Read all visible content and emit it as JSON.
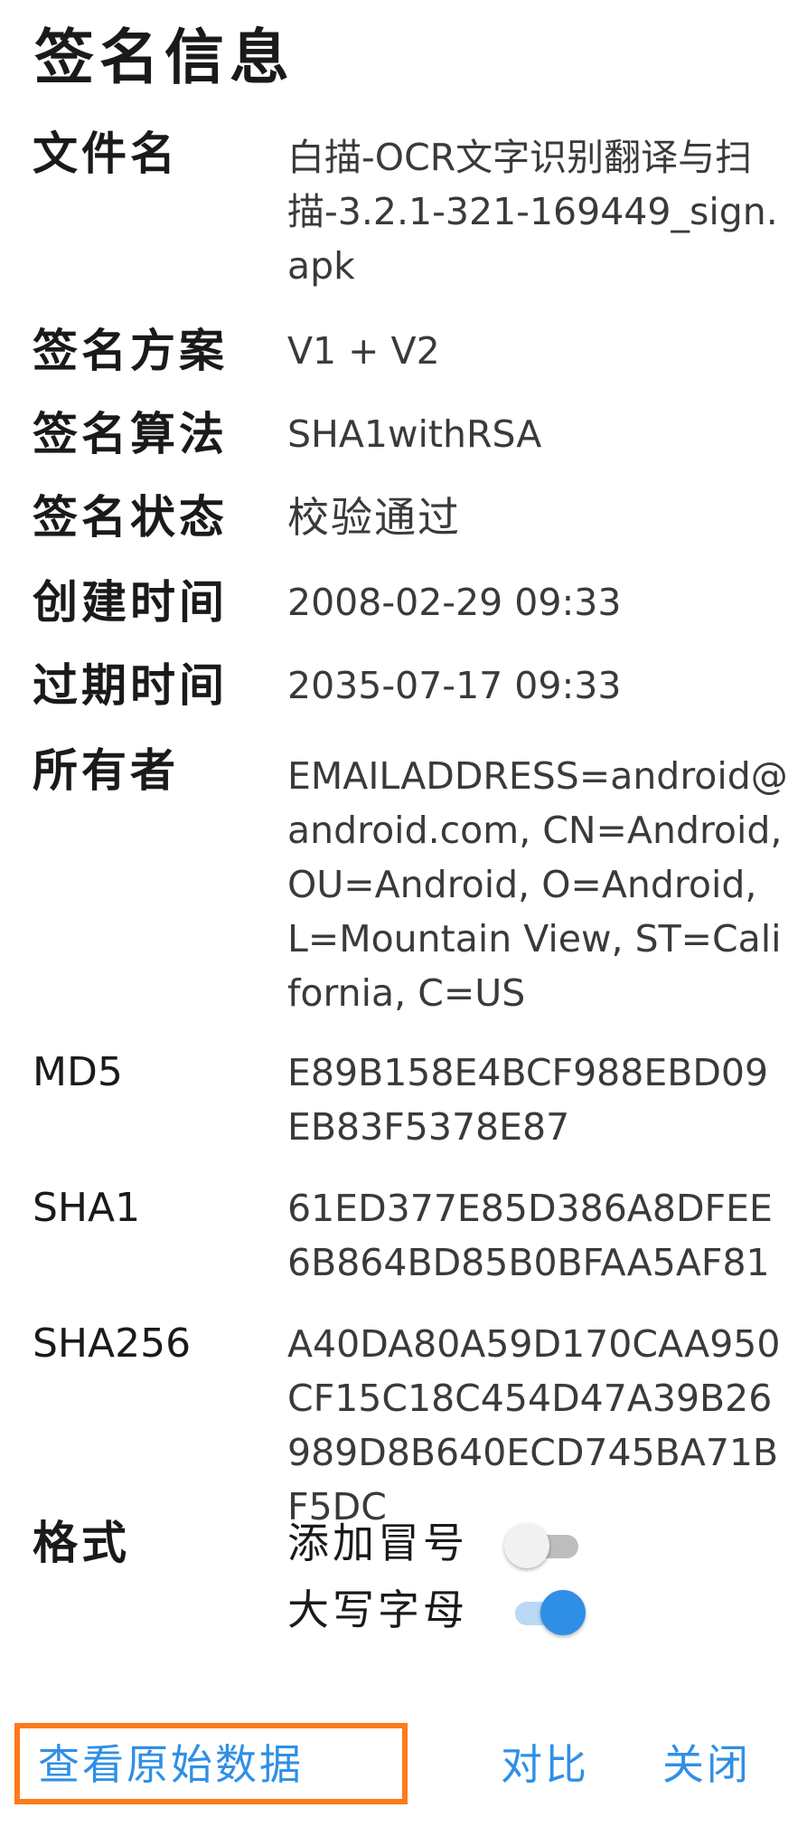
{
  "dialog": {
    "title": "签名信息",
    "fields": {
      "filename_label": "文件名",
      "filename_value": "白描-OCR文字识别翻译与扫描-3.2.1-321-169449_sign.apk",
      "scheme_label": "签名方案",
      "scheme_value": "V1 + V2",
      "algorithm_label": "签名算法",
      "algorithm_value": "SHA1withRSA",
      "status_label": "签名状态",
      "status_value": "校验通过",
      "created_label": "创建时间",
      "created_value": "2008-02-29 09:33",
      "expires_label": "过期时间",
      "expires_value": "2035-07-17 09:33",
      "owner_label": "所有者",
      "owner_value": "EMAILADDRESS=android@android.com, CN=Android, OU=Android, O=Android, L=Mountain View, ST=California, C=US",
      "md5_label": "MD5",
      "md5_value": "E89B158E4BCF988EBD09EB83F5378E87",
      "sha1_label": "SHA1",
      "sha1_value": "61ED377E85D386A8DFEE6B864BD85B0BFAA5AF81",
      "sha256_label": "SHA256",
      "sha256_value": "A40DA80A59D170CAA950CF15C18C454D47A39B26989D8B640ECD745BA71BF5DC",
      "format_label": "格式"
    },
    "format_options": {
      "colon_label": "添加冒号",
      "colon_enabled": false,
      "uppercase_label": "大写字母",
      "uppercase_enabled": true
    },
    "actions": {
      "view_raw_label": "查看原始数据",
      "compare_label": "对比",
      "close_label": "关闭"
    },
    "colors": {
      "accent": "#2f8fe6",
      "highlight_border": "#ff7a1a"
    }
  }
}
